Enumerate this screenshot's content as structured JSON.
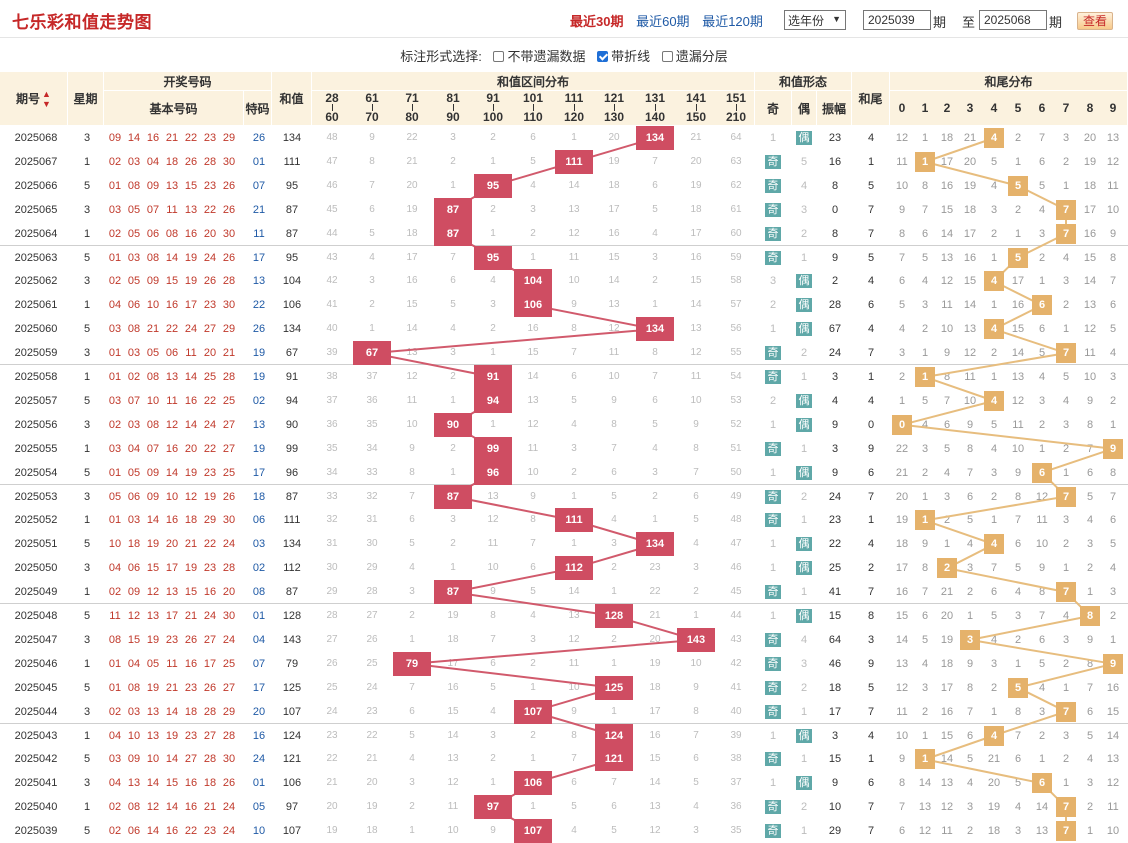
{
  "title": "七乐彩和值走势图",
  "periods": [
    "最近30期",
    "最近60期",
    "最近120期"
  ],
  "active_period": 0,
  "year_select": "选年份",
  "from_value": "2025039",
  "from_label": "期",
  "to_label": "至",
  "to_value": "2025068",
  "to_suffix": "期",
  "query_button": "查看",
  "options_label": "标注形式选择:",
  "options": [
    {
      "label": "不带遗漏数据",
      "checked": false
    },
    {
      "label": "带折线",
      "checked": true
    },
    {
      "label": "遗漏分层",
      "checked": false
    }
  ],
  "headers": {
    "issue": "期号",
    "week": "星期",
    "draw": "开奖号码",
    "basic": "基本号码",
    "special": "特码",
    "sum": "和值",
    "range_dist": "和值区间分布",
    "form": "和值形态",
    "odd": "奇",
    "even": "偶",
    "amp": "振幅",
    "tail": "和尾",
    "tail_dist": "和尾分布",
    "ranges": [
      [
        "28",
        "60"
      ],
      [
        "61",
        "70"
      ],
      [
        "71",
        "80"
      ],
      [
        "81",
        "90"
      ],
      [
        "91",
        "100"
      ],
      [
        "101",
        "110"
      ],
      [
        "111",
        "120"
      ],
      [
        "121",
        "130"
      ],
      [
        "131",
        "140"
      ],
      [
        "141",
        "150"
      ],
      [
        "151",
        "210"
      ]
    ],
    "tail_digits": [
      "0",
      "1",
      "2",
      "3",
      "4",
      "5",
      "6",
      "7",
      "8",
      "9"
    ]
  },
  "odd_badge": "奇",
  "even_badge": "偶",
  "rows": [
    {
      "issue": "2025068",
      "week": "3",
      "basic": [
        "09",
        "14",
        "16",
        "21",
        "22",
        "23",
        "29"
      ],
      "special": "26",
      "sum": 134,
      "range": [
        48,
        9,
        22,
        3,
        2,
        6,
        1,
        20,
        134,
        21,
        64
      ],
      "odd": 1,
      "even": "偶",
      "amp": "23",
      "tail": "4",
      "tailm": [
        12,
        1,
        18,
        21,
        4,
        2,
        7,
        3,
        20,
        13
      ]
    },
    {
      "issue": "2025067",
      "week": "1",
      "basic": [
        "02",
        "03",
        "04",
        "18",
        "26",
        "28",
        "30"
      ],
      "special": "01",
      "sum": 111,
      "range": [
        47,
        8,
        21,
        2,
        1,
        5,
        111,
        19,
        7,
        20,
        63
      ],
      "odd": "奇",
      "even": 5,
      "amp": "16",
      "tail": "1",
      "tailm": [
        11,
        1,
        17,
        20,
        5,
        1,
        6,
        2,
        19,
        12
      ]
    },
    {
      "issue": "2025066",
      "week": "5",
      "basic": [
        "01",
        "08",
        "09",
        "13",
        "15",
        "23",
        "26"
      ],
      "special": "07",
      "sum": 95,
      "range": [
        46,
        7,
        20,
        1,
        95,
        4,
        14,
        18,
        6,
        19,
        62
      ],
      "odd": "奇",
      "even": 4,
      "amp": "8",
      "tail": "5",
      "tailm": [
        10,
        8,
        16,
        19,
        4,
        5,
        5,
        1,
        18,
        11
      ]
    },
    {
      "issue": "2025065",
      "week": "3",
      "basic": [
        "03",
        "05",
        "07",
        "11",
        "13",
        "22",
        "26"
      ],
      "special": "21",
      "sum": 87,
      "range": [
        45,
        6,
        19,
        87,
        2,
        3,
        13,
        17,
        5,
        18,
        61
      ],
      "odd": "奇",
      "even": 3,
      "amp": "0",
      "tail": "7",
      "tailm": [
        9,
        7,
        15,
        18,
        3,
        2,
        4,
        7,
        17,
        10
      ]
    },
    {
      "issue": "2025064",
      "week": "1",
      "basic": [
        "02",
        "05",
        "06",
        "08",
        "16",
        "20",
        "30"
      ],
      "special": "11",
      "sum": 87,
      "range": [
        44,
        5,
        18,
        87,
        1,
        2,
        12,
        16,
        4,
        17,
        60
      ],
      "odd": "奇",
      "even": 2,
      "amp": "8",
      "tail": "7",
      "tailm": [
        8,
        6,
        14,
        17,
        2,
        1,
        3,
        7,
        16,
        9
      ]
    },
    {
      "issue": "2025063",
      "week": "5",
      "basic": [
        "01",
        "03",
        "08",
        "14",
        "19",
        "24",
        "26"
      ],
      "special": "17",
      "sum": 95,
      "range": [
        43,
        4,
        17,
        7,
        95,
        1,
        11,
        15,
        3,
        16,
        59
      ],
      "odd": "奇",
      "even": 1,
      "amp": "9",
      "tail": "5",
      "tailm": [
        7,
        5,
        13,
        16,
        1,
        5,
        2,
        4,
        15,
        8
      ]
    },
    {
      "issue": "2025062",
      "week": "3",
      "basic": [
        "02",
        "05",
        "09",
        "15",
        "19",
        "26",
        "28"
      ],
      "special": "13",
      "sum": 104,
      "range": [
        42,
        3,
        16,
        6,
        4,
        104,
        10,
        14,
        2,
        15,
        58
      ],
      "odd": 3,
      "even": "偶",
      "amp": "2",
      "tail": "4",
      "tailm": [
        6,
        4,
        12,
        15,
        4,
        17,
        1,
        3,
        14,
        7
      ]
    },
    {
      "issue": "2025061",
      "week": "1",
      "basic": [
        "04",
        "06",
        "10",
        "16",
        "17",
        "23",
        "30"
      ],
      "special": "22",
      "sum": 106,
      "range": [
        41,
        2,
        15,
        5,
        3,
        106,
        9,
        13,
        1,
        14,
        57
      ],
      "odd": 2,
      "even": "偶",
      "amp": "28",
      "tail": "6",
      "tailm": [
        5,
        3,
        11,
        14,
        1,
        16,
        6,
        2,
        13,
        6
      ]
    },
    {
      "issue": "2025060",
      "week": "5",
      "basic": [
        "03",
        "08",
        "21",
        "22",
        "24",
        "27",
        "29"
      ],
      "special": "26",
      "sum": 134,
      "range": [
        40,
        1,
        14,
        4,
        2,
        16,
        8,
        12,
        134,
        13,
        56
      ],
      "odd": 1,
      "even": "偶",
      "amp": "67",
      "tail": "4",
      "tailm": [
        4,
        2,
        10,
        13,
        4,
        15,
        6,
        1,
        12,
        5
      ]
    },
    {
      "issue": "2025059",
      "week": "3",
      "basic": [
        "01",
        "03",
        "05",
        "06",
        "11",
        "20",
        "21"
      ],
      "special": "19",
      "sum": 67,
      "range": [
        39,
        67,
        13,
        3,
        1,
        15,
        7,
        11,
        8,
        12,
        55
      ],
      "odd": "奇",
      "even": 2,
      "amp": "24",
      "tail": "7",
      "tailm": [
        3,
        1,
        9,
        12,
        2,
        14,
        5,
        7,
        11,
        4
      ]
    },
    {
      "issue": "2025058",
      "week": "1",
      "basic": [
        "01",
        "02",
        "08",
        "13",
        "14",
        "25",
        "28"
      ],
      "special": "19",
      "sum": 91,
      "range": [
        38,
        37,
        12,
        2,
        91,
        14,
        6,
        10,
        7,
        11,
        54
      ],
      "odd": "奇",
      "even": 1,
      "amp": "3",
      "tail": "1",
      "tailm": [
        2,
        1,
        8,
        11,
        1,
        13,
        4,
        5,
        10,
        3
      ]
    },
    {
      "issue": "2025057",
      "week": "5",
      "basic": [
        "03",
        "07",
        "10",
        "11",
        "16",
        "22",
        "25"
      ],
      "special": "02",
      "sum": 94,
      "range": [
        37,
        36,
        11,
        1,
        94,
        13,
        5,
        9,
        6,
        10,
        53
      ],
      "odd": 2,
      "even": "偶",
      "amp": "4",
      "tail": "4",
      "tailm": [
        1,
        5,
        7,
        10,
        4,
        12,
        3,
        4,
        9,
        2
      ]
    },
    {
      "issue": "2025056",
      "week": "3",
      "basic": [
        "02",
        "03",
        "08",
        "12",
        "14",
        "24",
        "27"
      ],
      "special": "13",
      "sum": 90,
      "range": [
        36,
        35,
        10,
        90,
        1,
        12,
        4,
        8,
        5,
        9,
        52
      ],
      "odd": 1,
      "even": "偶",
      "amp": "9",
      "tail": "0",
      "tailm": [
        0,
        4,
        6,
        9,
        5,
        11,
        2,
        3,
        8,
        1
      ]
    },
    {
      "issue": "2025055",
      "week": "1",
      "basic": [
        "03",
        "04",
        "07",
        "16",
        "20",
        "22",
        "27"
      ],
      "special": "19",
      "sum": 99,
      "range": [
        35,
        34,
        9,
        2,
        99,
        11,
        3,
        7,
        4,
        8,
        51
      ],
      "odd": "奇",
      "even": 1,
      "amp": "3",
      "tail": "9",
      "tailm": [
        22,
        3,
        5,
        8,
        4,
        10,
        1,
        2,
        7,
        9
      ]
    },
    {
      "issue": "2025054",
      "week": "5",
      "basic": [
        "01",
        "05",
        "09",
        "14",
        "19",
        "23",
        "25"
      ],
      "special": "17",
      "sum": 96,
      "range": [
        34,
        33,
        8,
        1,
        96,
        10,
        2,
        6,
        3,
        7,
        50
      ],
      "odd": 1,
      "even": "偶",
      "amp": "9",
      "tail": "6",
      "tailm": [
        21,
        2,
        4,
        7,
        3,
        9,
        6,
        1,
        6,
        8
      ]
    },
    {
      "issue": "2025053",
      "week": "3",
      "basic": [
        "05",
        "06",
        "09",
        "10",
        "12",
        "19",
        "26"
      ],
      "special": "18",
      "sum": 87,
      "range": [
        33,
        32,
        7,
        87,
        13,
        9,
        1,
        5,
        2,
        6,
        49
      ],
      "odd": "奇",
      "even": 2,
      "amp": "24",
      "tail": "7",
      "tailm": [
        20,
        1,
        3,
        6,
        2,
        8,
        12,
        7,
        5,
        7
      ]
    },
    {
      "issue": "2025052",
      "week": "1",
      "basic": [
        "01",
        "03",
        "14",
        "16",
        "18",
        "29",
        "30"
      ],
      "special": "06",
      "sum": 111,
      "range": [
        32,
        31,
        6,
        3,
        12,
        8,
        111,
        4,
        1,
        5,
        48
      ],
      "odd": "奇",
      "even": 1,
      "amp": "23",
      "tail": "1",
      "tailm": [
        19,
        1,
        2,
        5,
        1,
        7,
        11,
        3,
        4,
        6
      ]
    },
    {
      "issue": "2025051",
      "week": "5",
      "basic": [
        "10",
        "18",
        "19",
        "20",
        "21",
        "22",
        "24"
      ],
      "special": "03",
      "sum": 134,
      "range": [
        31,
        30,
        5,
        2,
        11,
        7,
        1,
        3,
        134,
        4,
        47
      ],
      "odd": 1,
      "even": "偶",
      "amp": "22",
      "tail": "4",
      "tailm": [
        18,
        9,
        1,
        4,
        4,
        6,
        10,
        2,
        3,
        5
      ]
    },
    {
      "issue": "2025050",
      "week": "3",
      "basic": [
        "04",
        "06",
        "15",
        "17",
        "19",
        "23",
        "28"
      ],
      "special": "02",
      "sum": 112,
      "range": [
        30,
        29,
        4,
        1,
        10,
        6,
        112,
        2,
        23,
        3,
        46
      ],
      "odd": 1,
      "even": "偶",
      "amp": "25",
      "tail": "2",
      "tailm": [
        17,
        8,
        2,
        3,
        7,
        5,
        9,
        1,
        2,
        4
      ]
    },
    {
      "issue": "2025049",
      "week": "1",
      "basic": [
        "02",
        "09",
        "12",
        "13",
        "15",
        "16",
        "20"
      ],
      "special": "08",
      "sum": 87,
      "range": [
        29,
        28,
        3,
        87,
        9,
        5,
        14,
        1,
        22,
        2,
        45
      ],
      "odd": "奇",
      "even": 1,
      "amp": "41",
      "tail": "7",
      "tailm": [
        16,
        7,
        21,
        2,
        6,
        4,
        8,
        7,
        1,
        3
      ]
    },
    {
      "issue": "2025048",
      "week": "5",
      "basic": [
        "11",
        "12",
        "13",
        "17",
        "21",
        "24",
        "30"
      ],
      "special": "01",
      "sum": 128,
      "range": [
        28,
        27,
        2,
        19,
        8,
        4,
        13,
        128,
        21,
        1,
        44
      ],
      "odd": 1,
      "even": "偶",
      "amp": "15",
      "tail": "8",
      "tailm": [
        15,
        6,
        20,
        1,
        5,
        3,
        7,
        4,
        8,
        2
      ]
    },
    {
      "issue": "2025047",
      "week": "3",
      "basic": [
        "08",
        "15",
        "19",
        "23",
        "26",
        "27",
        "24"
      ],
      "special": "04",
      "sum": 143,
      "range": [
        27,
        26,
        1,
        18,
        7,
        3,
        12,
        2,
        20,
        143,
        43
      ],
      "odd": "奇",
      "even": 4,
      "amp": "64",
      "tail": "3",
      "tailm": [
        14,
        5,
        19,
        3,
        4,
        2,
        6,
        3,
        9,
        1
      ]
    },
    {
      "issue": "2025046",
      "week": "1",
      "basic": [
        "01",
        "04",
        "05",
        "11",
        "16",
        "17",
        "25"
      ],
      "special": "07",
      "sum": 79,
      "range": [
        26,
        25,
        79,
        17,
        6,
        2,
        11,
        1,
        19,
        10,
        42
      ],
      "odd": "奇",
      "even": 3,
      "amp": "46",
      "tail": "9",
      "tailm": [
        13,
        4,
        18,
        9,
        3,
        1,
        5,
        2,
        8,
        9
      ]
    },
    {
      "issue": "2025045",
      "week": "5",
      "basic": [
        "01",
        "08",
        "19",
        "21",
        "23",
        "26",
        "27"
      ],
      "special": "17",
      "sum": 125,
      "range": [
        25,
        24,
        7,
        16,
        5,
        1,
        10,
        125,
        18,
        9,
        41
      ],
      "odd": "奇",
      "even": 2,
      "amp": "18",
      "tail": "5",
      "tailm": [
        12,
        3,
        17,
        8,
        2,
        5,
        4,
        1,
        7,
        16
      ]
    },
    {
      "issue": "2025044",
      "week": "3",
      "basic": [
        "02",
        "03",
        "13",
        "14",
        "18",
        "28",
        "29"
      ],
      "special": "20",
      "sum": 107,
      "range": [
        24,
        23,
        6,
        15,
        4,
        107,
        9,
        1,
        17,
        8,
        40
      ],
      "odd": "奇",
      "even": 1,
      "amp": "17",
      "tail": "7",
      "tailm": [
        11,
        2,
        16,
        7,
        1,
        8,
        3,
        7,
        6,
        15
      ]
    },
    {
      "issue": "2025043",
      "week": "1",
      "basic": [
        "04",
        "10",
        "13",
        "19",
        "23",
        "27",
        "28"
      ],
      "special": "16",
      "sum": 124,
      "range": [
        23,
        22,
        5,
        14,
        3,
        2,
        8,
        124,
        16,
        7,
        39
      ],
      "odd": 1,
      "even": "偶",
      "amp": "3",
      "tail": "4",
      "tailm": [
        10,
        1,
        15,
        6,
        4,
        7,
        2,
        3,
        5,
        14
      ]
    },
    {
      "issue": "2025042",
      "week": "5",
      "basic": [
        "03",
        "09",
        "10",
        "14",
        "27",
        "28",
        "30"
      ],
      "special": "24",
      "sum": 121,
      "range": [
        22,
        21,
        4,
        13,
        2,
        1,
        7,
        121,
        15,
        6,
        38
      ],
      "odd": "奇",
      "even": 1,
      "amp": "15",
      "tail": "1",
      "tailm": [
        9,
        1,
        14,
        5,
        21,
        6,
        1,
        2,
        4,
        13
      ]
    },
    {
      "issue": "2025041",
      "week": "3",
      "basic": [
        "04",
        "13",
        "14",
        "15",
        "16",
        "18",
        "26"
      ],
      "special": "01",
      "sum": 106,
      "range": [
        21,
        20,
        3,
        12,
        1,
        106,
        6,
        7,
        14,
        5,
        37
      ],
      "odd": 1,
      "even": "偶",
      "amp": "9",
      "tail": "6",
      "tailm": [
        8,
        14,
        13,
        4,
        20,
        5,
        6,
        1,
        3,
        12
      ]
    },
    {
      "issue": "2025040",
      "week": "1",
      "basic": [
        "02",
        "08",
        "12",
        "14",
        "16",
        "21",
        "24"
      ],
      "special": "05",
      "sum": 97,
      "range": [
        20,
        19,
        2,
        11,
        97,
        1,
        5,
        6,
        13,
        4,
        36
      ],
      "odd": "奇",
      "even": 2,
      "amp": "10",
      "tail": "7",
      "tailm": [
        7,
        13,
        12,
        3,
        19,
        4,
        14,
        7,
        2,
        11
      ]
    },
    {
      "issue": "2025039",
      "week": "5",
      "basic": [
        "02",
        "06",
        "14",
        "16",
        "22",
        "23",
        "24"
      ],
      "special": "10",
      "sum": 107,
      "range": [
        19,
        18,
        1,
        10,
        9,
        107,
        4,
        5,
        12,
        3,
        35
      ],
      "odd": "奇",
      "even": 1,
      "amp": "29",
      "tail": "7",
      "tailm": [
        6,
        12,
        11,
        2,
        18,
        3,
        13,
        7,
        1,
        10
      ]
    }
  ]
}
